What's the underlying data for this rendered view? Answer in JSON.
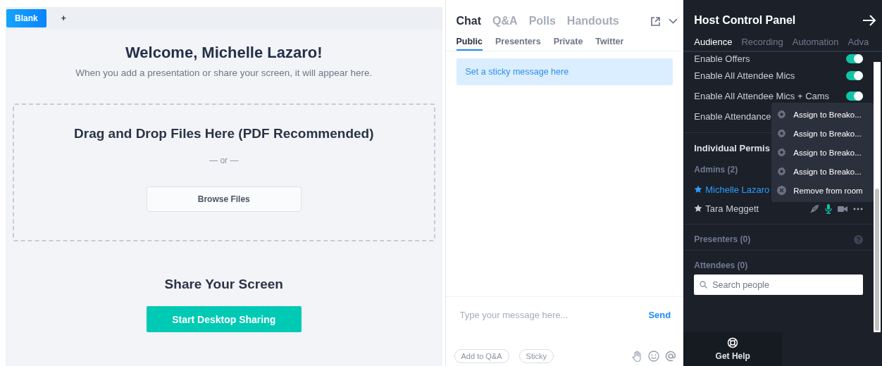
{
  "stage": {
    "tabs": [
      {
        "label": "Blank",
        "selected": true
      },
      {
        "label": "+",
        "selected": false
      }
    ],
    "welcome_title": "Welcome, Michelle Lazaro!",
    "welcome_text": "When you add a presentation or share your screen, it will appear here.",
    "dropzone": {
      "title": "Drag and Drop Files Here (PDF Recommended)",
      "separator": "— or —",
      "button": "Browse Files"
    },
    "share": {
      "title": "Share Your Screen",
      "button": "Start Desktop Sharing"
    }
  },
  "chat": {
    "tabs": [
      {
        "label": "Chat",
        "selected": true
      },
      {
        "label": "Q&A",
        "selected": false
      },
      {
        "label": "Polls",
        "selected": false
      },
      {
        "label": "Handouts",
        "selected": false
      }
    ],
    "subtabs": [
      {
        "label": "Public",
        "selected": true
      },
      {
        "label": "Presenters",
        "selected": false
      },
      {
        "label": "Private",
        "selected": false
      },
      {
        "label": "Twitter",
        "selected": false
      }
    ],
    "sticky": "Set a sticky message here",
    "input": {
      "placeholder": "Type your message here..."
    },
    "send": "Send",
    "chips": [
      "Add to Q&A",
      "Sticky"
    ]
  },
  "host": {
    "title": "Host Control Panel",
    "tabs": [
      {
        "label": "Audience",
        "selected": true
      },
      {
        "label": "Recording",
        "selected": false
      },
      {
        "label": "Automation",
        "selected": false
      },
      {
        "label": "Adva",
        "selected": false
      }
    ],
    "toggles": [
      {
        "label": "Enable Offers",
        "on": true
      },
      {
        "label": "Enable All Attendee Mics",
        "on": true
      },
      {
        "label": "Enable All Attendee Mics + Cams",
        "on": true
      },
      {
        "label": "Enable Attendance"
      }
    ],
    "permissions_title": "Individual Permis",
    "admins_label": "Admins (2)",
    "admins": [
      {
        "name": "Michelle Lazaro",
        "selected": true
      },
      {
        "name": "Tara Meggett",
        "selected": false
      }
    ],
    "presenters_label": "Presenters (0)",
    "attendees_label": "Attendees (0)",
    "search": {
      "placeholder": "Search people"
    },
    "menu": [
      {
        "kind": "gear",
        "label": "Assign to Breako..."
      },
      {
        "kind": "gear",
        "label": "Assign to Breako..."
      },
      {
        "kind": "gear",
        "label": "Assign to Breako..."
      },
      {
        "kind": "gear",
        "label": "Assign to Breako..."
      },
      {
        "kind": "remove",
        "label": "Remove from room"
      }
    ],
    "help": "Get Help"
  }
}
